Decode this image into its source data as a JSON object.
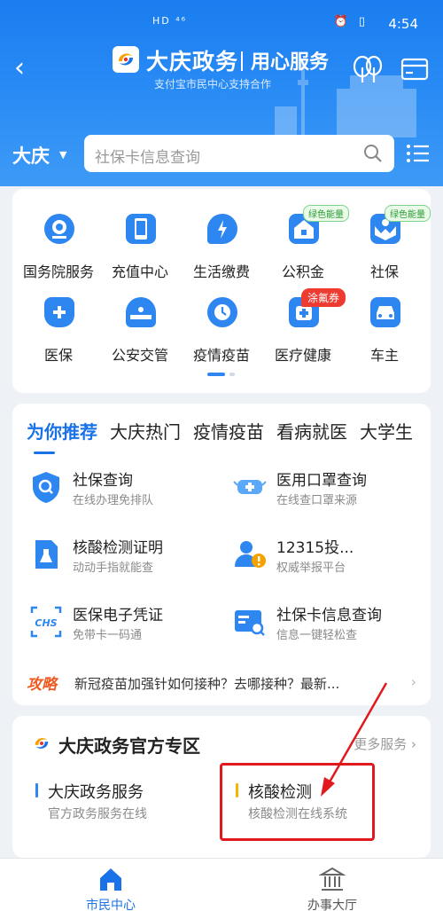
{
  "status_bar": {
    "network": "HD ⁴⁶",
    "time": "4:54"
  },
  "header": {
    "brand": "大庆政务",
    "slogan": "用心服务",
    "subtitle": "支付宝市民中心支持合作"
  },
  "location": {
    "city": "大庆"
  },
  "search": {
    "placeholder": "社保卡信息查询"
  },
  "grid": [
    {
      "label": "国务院服务",
      "icon": "state-council-icon"
    },
    {
      "label": "充值中心",
      "icon": "phone-recharge-icon"
    },
    {
      "label": "生活缴费",
      "icon": "utility-payment-icon"
    },
    {
      "label": "公积金",
      "icon": "housing-fund-icon",
      "badge": "绿色能量"
    },
    {
      "label": "社保",
      "icon": "social-security-icon",
      "badge": "绿色能量"
    },
    {
      "label": "医保",
      "icon": "medical-insurance-icon"
    },
    {
      "label": "公安交管",
      "icon": "police-traffic-icon"
    },
    {
      "label": "疫情疫苗",
      "icon": "vaccine-icon"
    },
    {
      "label": "医疗健康",
      "icon": "healthcare-icon",
      "badge": "涂氟券"
    },
    {
      "label": "车主",
      "icon": "car-owner-icon"
    }
  ],
  "recommend_tabs": [
    "为你推荐",
    "大庆热门",
    "疫情疫苗",
    "看病就医",
    "大学生"
  ],
  "services": [
    {
      "title": "社保查询",
      "desc": "在线办理免排队",
      "icon": "shield-search-icon"
    },
    {
      "title": "医用口罩查询",
      "desc": "在线查口罩来源",
      "icon": "mask-icon"
    },
    {
      "title": "核酸检测证明",
      "desc": "动动手指就能查",
      "icon": "lab-report-icon"
    },
    {
      "title": "12315投...",
      "desc": "权威举报平台",
      "icon": "complaint-icon"
    },
    {
      "title": "医保电子凭证",
      "desc": "免带卡一码通",
      "icon": "chs-card-icon"
    },
    {
      "title": "社保卡信息查询",
      "desc": "信息一键轻松查",
      "icon": "card-search-icon"
    }
  ],
  "strategy": {
    "tag": "攻略",
    "text": "新冠疫苗加强针如何接种？去哪接种？最新..."
  },
  "official_zone": {
    "title": "大庆政务官方专区",
    "more": "更多服务",
    "items": [
      {
        "title": "大庆政务服务",
        "desc": "官方政务服务在线",
        "bar_color": "#2e86f0"
      },
      {
        "title": "核酸检测",
        "desc": "核酸检测在线系统",
        "bar_color": "#f5b400"
      }
    ]
  },
  "bottom_nav": [
    {
      "label": "市民中心",
      "active": true
    },
    {
      "label": "办事大厅",
      "active": false
    }
  ],
  "colors": {
    "primary": "#1a72e8",
    "header": "#2b8df5",
    "annotation": "#e0191e",
    "strategy": "#f15a22"
  }
}
